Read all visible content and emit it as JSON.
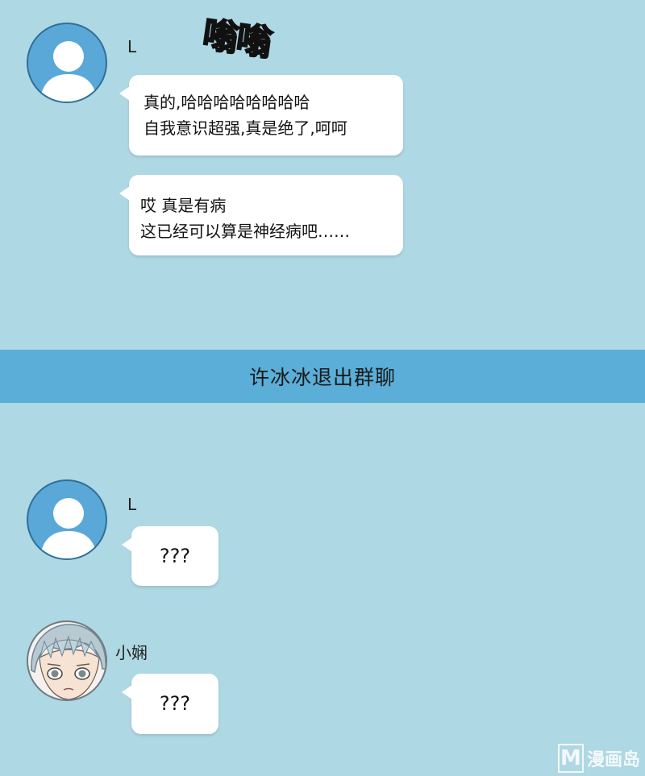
{
  "sfx": "嗡嗡",
  "messages": [
    {
      "sender": "L",
      "avatar": "default-person-icon",
      "bubbles": [
        {
          "lines": [
            "真的,哈哈哈哈哈哈哈哈",
            "自我意识超强,真是绝了,呵呵"
          ]
        },
        {
          "lines": [
            "哎 真是有病",
            "这已经可以算是神经病吧……"
          ]
        }
      ]
    }
  ],
  "system_notice": "许冰冰退出群聊",
  "messages_after": [
    {
      "sender": "L",
      "avatar": "default-person-icon",
      "bubbles": [
        {
          "lines": [
            "???"
          ]
        }
      ]
    },
    {
      "sender": "小娴",
      "avatar": "girl-portrait",
      "bubbles": [
        {
          "lines": [
            "???"
          ]
        }
      ]
    }
  ],
  "watermark": {
    "logo": "M",
    "text": "漫画岛"
  },
  "colors": {
    "background": "#aed8e3",
    "banner": "#5aaed8",
    "avatar_default": "#5aa8d8",
    "bubble": "#ffffff"
  }
}
